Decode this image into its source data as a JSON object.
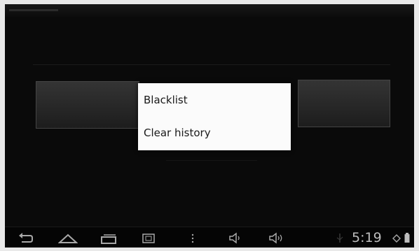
{
  "dialog": {
    "items": [
      {
        "label": "Blacklist"
      },
      {
        "label": "Clear history"
      }
    ]
  },
  "navbar": {
    "time": "5:19",
    "icons": [
      "back-icon",
      "home-icon",
      "recent-apps-icon",
      "screenshot-icon",
      "menu-icon",
      "volume-down-icon",
      "volume-up-icon",
      "usb-icon",
      "wifi-icon",
      "battery-icon"
    ]
  },
  "colors": {
    "background": "#0b0b0b",
    "dialog": "#fbfbfb",
    "dialog_text": "#1a1a1a",
    "nav_icons": "#a8a8a8"
  }
}
